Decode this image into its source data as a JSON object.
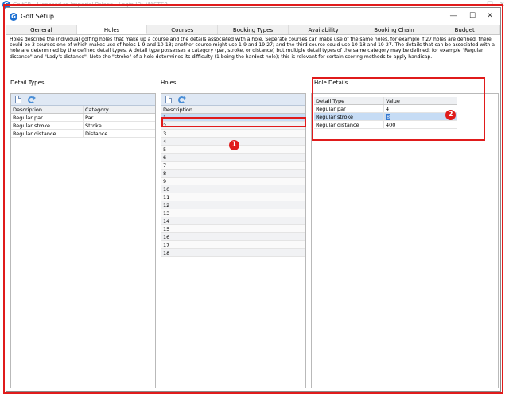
{
  "outer_title": "GolfER - Licensed to Imperial Palace - Login ID: MASTER",
  "window": {
    "title": "Golf Setup",
    "app_icon_glyph": "G",
    "controls": {
      "minimize": "—",
      "maximize": "☐",
      "close": "✕"
    }
  },
  "tabs": [
    "General",
    "Holes",
    "Courses",
    "Booking Types",
    "Availability",
    "Booking Chain",
    "Budget"
  ],
  "active_tab": "Holes",
  "description": "Holes describe the individual golfing holes that make up a course and the details associated with a hole. Seperate courses can make use of the same holes, for example if 27 holes are defined, there could be 3 courses one of which makes use of holes 1-9 and 10-18; another course might use 1-9 and 19-27; and the third course could use 10-18 and 19-27. The details that can be associated with a hole are determined by the defined detail types. A detail type possesses a category (par, stroke, or distance) but multiple detail types of the same category may be defined; for example \"Regular distance\" and \"Lady's distance\". Note the \"stroke\" of a hole determines its difficulty (1 being the hardest hole); this is relevant for certain scoring methods to apply handicap.",
  "detail_types": {
    "title": "Detail Types",
    "columns": [
      "Description",
      "Category"
    ],
    "rows": [
      [
        "Regular par",
        "Par"
      ],
      [
        "Regular stroke",
        "Stroke"
      ],
      [
        "Regular distance",
        "Distance"
      ]
    ]
  },
  "holes": {
    "title": "Holes",
    "column": "Description",
    "selected_index": 0,
    "rows": [
      "1",
      "2",
      "3",
      "4",
      "5",
      "6",
      "7",
      "8",
      "9",
      "10",
      "11",
      "12",
      "13",
      "14",
      "15",
      "16",
      "17",
      "18"
    ]
  },
  "hole_details": {
    "title": "Hole Details",
    "columns": [
      "Detail Type",
      "Value"
    ],
    "rows": [
      [
        "Regular par",
        "4"
      ],
      [
        "Regular stroke",
        "8"
      ],
      [
        "Regular distance",
        "400"
      ]
    ],
    "selected_index": 1
  },
  "callouts": {
    "one": "1",
    "two": "2"
  },
  "colors": {
    "highlight": "#e01b1b",
    "selection": "#c6dcf5",
    "toolbar": "#dfe8f4"
  }
}
